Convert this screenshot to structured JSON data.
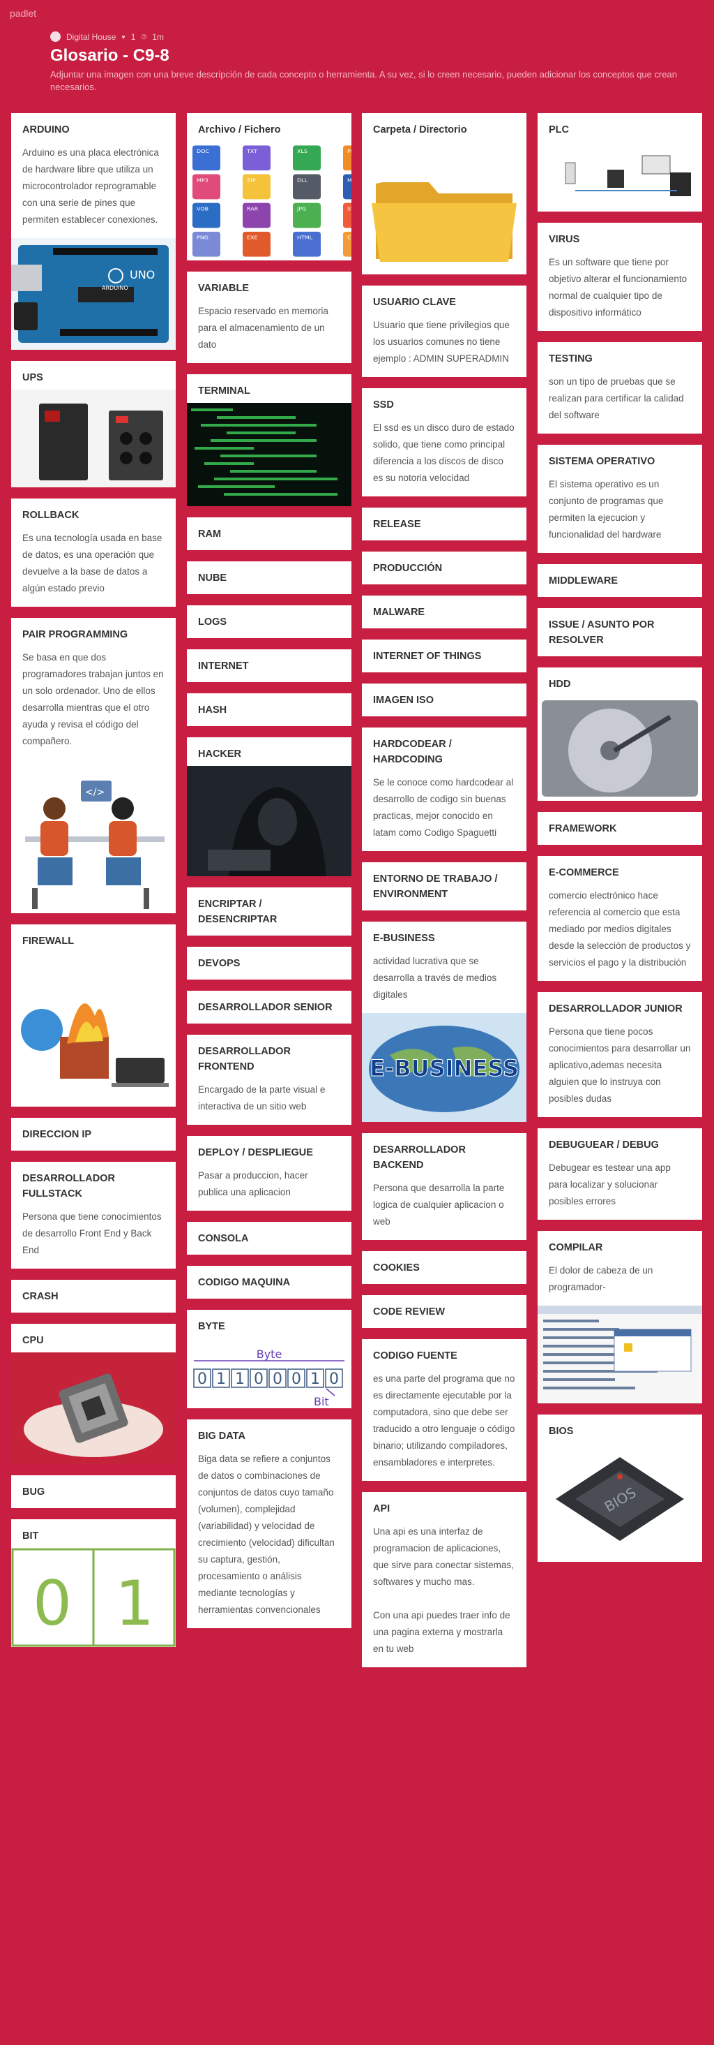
{
  "app": {
    "logo": "padlet"
  },
  "header": {
    "author": "Digital House",
    "likes": "1",
    "time": "1m",
    "title": "Glosario - C9-8",
    "description": "Adjuntar una imagen con una breve descripción de cada concepto o herramienta. A su vez, si lo creen necesario, pueden adicionar los conceptos que crean necesarios."
  },
  "columns": [
    [
      {
        "title": "ARDUINO",
        "body": "Arduino es una placa electrónica de hardware libre que utiliza un microcontrolador reprogramable con una serie de pines que permiten establecer conexiones.",
        "image": "arduino-board"
      },
      {
        "title": "UPS",
        "body": "",
        "image": "ups-devices"
      },
      {
        "title": "ROLLBACK",
        "body": "Es una tecnología usada en base de datos, es una operación que devuelve a la base de datos a algún estado previo"
      },
      {
        "title": "PAIR PROGRAMMING",
        "body": "Se basa en que dos programadores trabajan juntos en un solo ordenador. Uno de ellos desarrolla mientras que el otro ayuda y revisa el código del compañero.",
        "image": "pair-programmers"
      },
      {
        "title": "FIREWALL",
        "body": "",
        "image": "firewall"
      },
      {
        "title": "DIRECCION IP",
        "body": ""
      },
      {
        "title": "DESARROLLADOR FULLSTACK",
        "body": "Persona que tiene conocimientos de desarrollo Front End y Back End"
      },
      {
        "title": "CRASH",
        "body": ""
      },
      {
        "title": "CPU",
        "body": "",
        "image": "cpu-chip"
      },
      {
        "title": "BUG",
        "body": ""
      },
      {
        "title": "BIT",
        "body": "",
        "image": "bit-zero-one",
        "bit_values": [
          "0",
          "1"
        ]
      }
    ],
    [
      {
        "title": "Archivo / Fichero",
        "body": "",
        "image": "file-icons",
        "file_types": [
          "DOC",
          "TXT",
          "XLS",
          "PPT",
          "MP3",
          "ZIP",
          "DLL",
          "MOV",
          "VOB",
          "RAR",
          "JPG",
          "SWF",
          "PNG",
          "EXE",
          "HTML",
          "CSS"
        ]
      },
      {
        "title": "VARIABLE",
        "body": "Espacio reservado en memoria para el almacenamiento de un dato"
      },
      {
        "title": "TERMINAL",
        "body": "",
        "image": "terminal-screen"
      },
      {
        "title": "RAM",
        "body": ""
      },
      {
        "title": "NUBE",
        "body": ""
      },
      {
        "title": "LOGS",
        "body": ""
      },
      {
        "title": "INTERNET",
        "body": ""
      },
      {
        "title": "HASH",
        "body": ""
      },
      {
        "title": "HACKER",
        "body": "",
        "image": "hacker-hood"
      },
      {
        "title": "ENCRIPTAR / DESENCRIPTAR",
        "body": ""
      },
      {
        "title": "DEVOPS",
        "body": ""
      },
      {
        "title": "DESARROLLADOR SENIOR",
        "body": ""
      },
      {
        "title": "DESARROLLADOR FRONTEND",
        "body": "Encargado de la parte visual e interactiva de un sitio web"
      },
      {
        "title": "DEPLOY / DESPLIEGUE",
        "body": "Pasar a produccion, hacer publica una aplicacion"
      },
      {
        "title": "CONSOLA",
        "body": ""
      },
      {
        "title": "CODIGO MAQUINA",
        "body": ""
      },
      {
        "title": "BYTE",
        "body": "",
        "image": "byte-diagram",
        "byte_label": "Byte",
        "bit_label": "Bit",
        "bits": [
          "0",
          "1",
          "1",
          "0",
          "0",
          "0",
          "1",
          "0"
        ]
      },
      {
        "title": "BIG DATA",
        "body": "Biga data se refiere a conjuntos de datos o combinaciones de conjuntos de datos cuyo tamaño (volumen), complejidad (variabilidad) y velocidad de crecimiento (velocidad) dificultan su captura, gestión, procesamiento o análisis mediante tecnologías y herramientas convencionales"
      }
    ],
    [
      {
        "title": "Carpeta / Directorio",
        "body": "",
        "image": "folder-icon"
      },
      {
        "title": "USUARIO CLAVE",
        "body": "Usuario que tiene privilegios que los usuarios comunes no tiene ejemplo : ADMIN SUPERADMIN"
      },
      {
        "title": "SSD",
        "body": "El ssd es un disco duro de estado solido, que tiene como principal diferencia a los discos de disco es su notoria velocidad"
      },
      {
        "title": "RELEASE",
        "body": ""
      },
      {
        "title": "PRODUCCIÓN",
        "body": ""
      },
      {
        "title": "MALWARE",
        "body": ""
      },
      {
        "title": "INTERNET OF THINGS",
        "body": ""
      },
      {
        "title": "IMAGEN ISO",
        "body": ""
      },
      {
        "title": "HARDCODEAR / HARDCODING",
        "body": "Se le conoce como hardcodear al desarrollo de codigo sin buenas practicas, mejor conocido en latam como Codigo Spaguetti"
      },
      {
        "title": "ENTORNO DE TRABAJO / ENVIRONMENT",
        "body": ""
      },
      {
        "title": "E-BUSINESS",
        "body": "actividad lucrativa que se desarrolla a través de medios digitales",
        "image": "ebusiness-banner",
        "banner_text": "E-BUSINESS"
      },
      {
        "title": "DESARROLLADOR BACKEND",
        "body": "Persona que desarrolla la parte logica de cualquier aplicacion o web"
      },
      {
        "title": "COOKIES",
        "body": ""
      },
      {
        "title": "CODE REVIEW",
        "body": ""
      },
      {
        "title": "CODIGO FUENTE",
        "body": "es una parte del programa que no es directamente ejecutable por la computadora, sino que debe ser traducido a otro lenguaje o código binario; utilizando compiladores, ensambladores e interpretes."
      },
      {
        "title": "API",
        "body": "Una api es una interfaz de programacion de aplicaciones, que sirve para conectar sistemas, softwares y mucho mas.\n\nCon una api puedes traer info de una pagina externa y mostrarla en tu web"
      }
    ],
    [
      {
        "title": "PLC",
        "body": "",
        "image": "plc-network"
      },
      {
        "title": "VIRUS",
        "body": "Es un software que tiene por objetivo alterar el funcionamiento normal de cualquier tipo de dispositivo informático"
      },
      {
        "title": "TESTING",
        "body": "son un tipo de pruebas que se realizan para certificar la calidad del software"
      },
      {
        "title": "SISTEMA OPERATIVO",
        "body": "El sistema operativo es un conjunto de programas que permiten la ejecucion y funcionalidad del hardware"
      },
      {
        "title": "MIDDLEWARE",
        "body": ""
      },
      {
        "title": "ISSUE / ASUNTO POR RESOLVER",
        "body": ""
      },
      {
        "title": "HDD",
        "body": "",
        "image": "hard-disk"
      },
      {
        "title": "FRAMEWORK",
        "body": ""
      },
      {
        "title": "E-COMMERCE",
        "body": "comercio electrónico hace referencia al comercio que esta mediado por medios digitales desde la selección de productos y servicios el pago y la distribución"
      },
      {
        "title": "DESARROLLADOR JUNIOR",
        "body": "Persona que tiene pocos conocimientos para desarrollar un aplicativo,ademas necesita alguien que lo instruya con posibles dudas"
      },
      {
        "title": "DEBUGUEAR / DEBUG",
        "body": "Debugear es testear una app para localizar y solucionar posibles errores"
      },
      {
        "title": "COMPILAR",
        "body": "El dolor de cabeza de un programador-",
        "image": "compiler-window"
      },
      {
        "title": "BIOS",
        "body": "",
        "image": "bios-chip",
        "chip_label": "BIOS"
      }
    ]
  ]
}
